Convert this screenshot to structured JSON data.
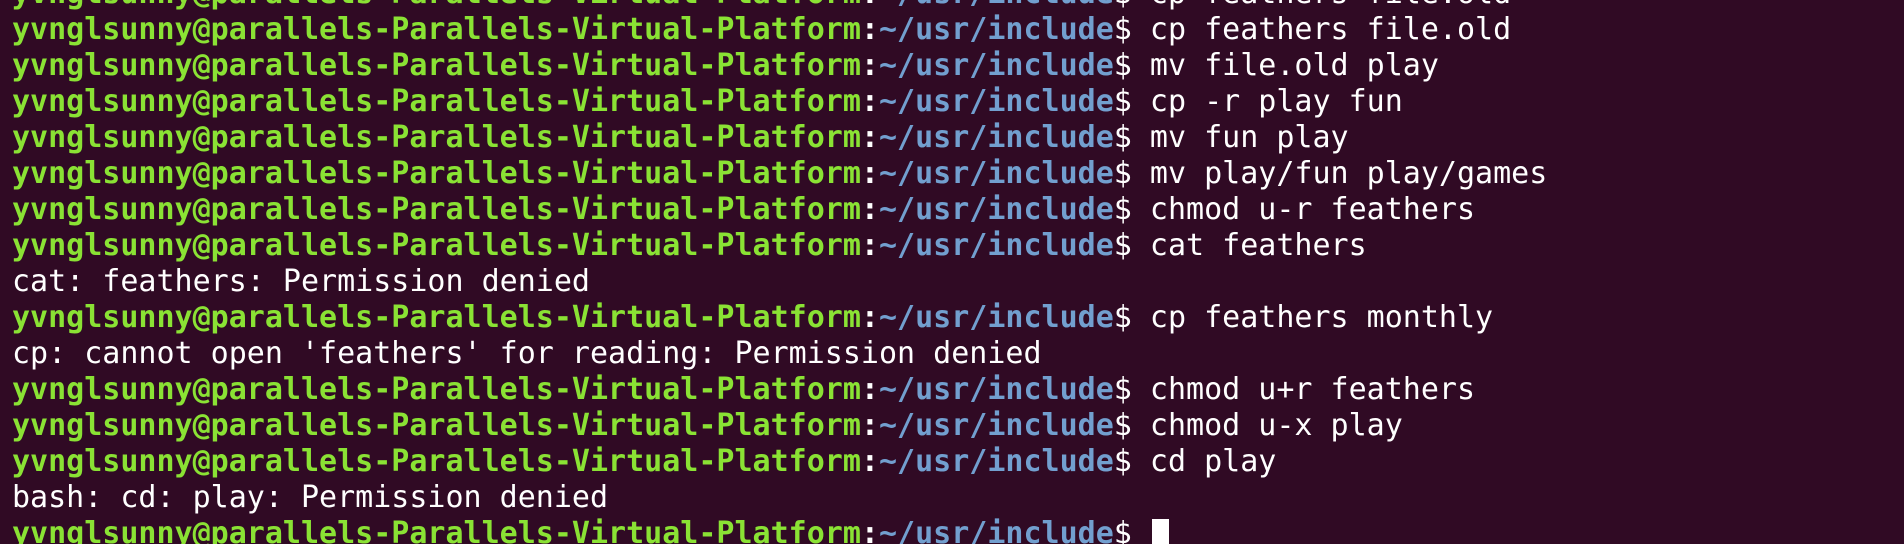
{
  "prompt": {
    "user_host": "yvnglsunny@parallels-Parallels-Virtual-Platform",
    "separator": ":",
    "path": "~/usr/include",
    "symbol": "$ "
  },
  "lines": [
    {
      "kind": "prompt",
      "command": "cp feathers file.old"
    },
    {
      "kind": "prompt",
      "command": "cp feathers file.old"
    },
    {
      "kind": "prompt",
      "command": "mv file.old play"
    },
    {
      "kind": "prompt",
      "command": "cp -r play fun"
    },
    {
      "kind": "prompt",
      "command": "mv fun play"
    },
    {
      "kind": "prompt",
      "command": "mv play/fun play/games"
    },
    {
      "kind": "prompt",
      "command": "chmod u-r feathers"
    },
    {
      "kind": "prompt",
      "command": "cat feathers"
    },
    {
      "kind": "output",
      "text": "cat: feathers: Permission denied"
    },
    {
      "kind": "prompt",
      "command": "cp feathers monthly"
    },
    {
      "kind": "output",
      "text": "cp: cannot open 'feathers' for reading: Permission denied"
    },
    {
      "kind": "prompt",
      "command": "chmod u+r feathers"
    },
    {
      "kind": "prompt",
      "command": "chmod u-x play"
    },
    {
      "kind": "prompt",
      "command": "cd play"
    },
    {
      "kind": "output",
      "text": "bash: cd: play: Permission denied"
    },
    {
      "kind": "prompt",
      "command": ""
    }
  ],
  "colors": {
    "background": "#300a24",
    "user_host": "#8ae234",
    "path": "#729fcf",
    "text": "#ffffff"
  }
}
